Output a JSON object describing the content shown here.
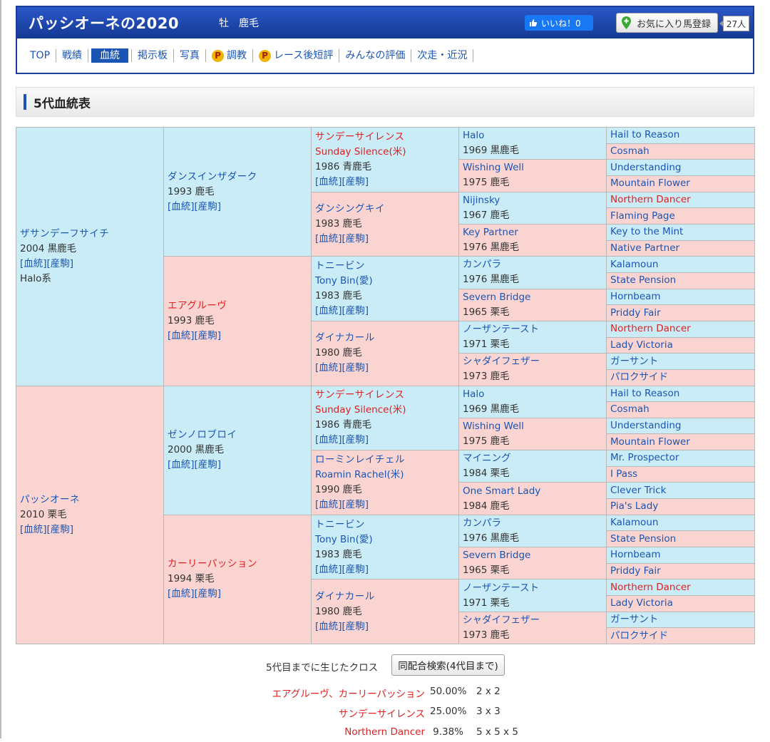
{
  "horse": {
    "name": "パッシオーネの2020",
    "sex_color": "牡　鹿毛",
    "like_label": "いいね！0",
    "fav_label": "お気に入り馬登録",
    "fav_count": "27人"
  },
  "nav": [
    {
      "label": "TOP"
    },
    {
      "label": "戦績"
    },
    {
      "label": "血統",
      "active": true
    },
    {
      "label": "掲示板"
    },
    {
      "label": "写真"
    },
    {
      "label": "調教",
      "premium": true
    },
    {
      "label": "レース後短評",
      "premium": true
    },
    {
      "label": "みんなの評価"
    },
    {
      "label": "次走・近況"
    }
  ],
  "section_title": "5代血統表",
  "pedigree": {
    "sire": {
      "jp": "ザサンデーフサイチ",
      "info": "2004 黒鹿毛",
      "links": "[血統][産駒]",
      "line": "Halo系"
    },
    "dam": {
      "jp": "パッシオーネ",
      "info": "2010 栗毛",
      "links": "[血統][産駒]"
    },
    "g2": [
      {
        "jp": "ダンスインザダーク",
        "info": "1993 鹿毛",
        "links": "[血統][産駒]"
      },
      {
        "jp": "エアグルーヴ",
        "info": "1993 鹿毛",
        "links": "[血統][産駒]",
        "red": true
      },
      {
        "jp": "ゼンノロブロイ",
        "info": "2000 黒鹿毛",
        "links": "[血統][産駒]"
      },
      {
        "jp": "カーリーパッション",
        "info": "1994 栗毛",
        "links": "[血統][産駒]",
        "red": true
      }
    ],
    "g3": [
      {
        "jp": "サンデーサイレンス",
        "en": "Sunday Silence(米)",
        "info": "1986 青鹿毛",
        "links": "[血統][産駒]",
        "red": true
      },
      {
        "jp": "ダンシングキイ",
        "info": "1983 鹿毛",
        "links": "[血統][産駒]"
      },
      {
        "jp": "トニービン",
        "en": "Tony Bin(愛)",
        "info": "1983 鹿毛",
        "links": "[血統][産駒]"
      },
      {
        "jp": "ダイナカール",
        "info": "1980 鹿毛",
        "links": "[血統][産駒]"
      },
      {
        "jp": "サンデーサイレンス",
        "en": "Sunday Silence(米)",
        "info": "1986 青鹿毛",
        "links": "[血統][産駒]",
        "red": true
      },
      {
        "jp": "ローミンレイチェル",
        "en": "Roamin Rachel(米)",
        "info": "1990 鹿毛",
        "links": "[血統][産駒]"
      },
      {
        "jp": "トニービン",
        "en": "Tony Bin(愛)",
        "info": "1983 鹿毛",
        "links": "[血統][産駒]"
      },
      {
        "jp": "ダイナカール",
        "info": "1980 鹿毛",
        "links": "[血統][産駒]"
      }
    ],
    "g4": [
      {
        "name": "Halo",
        "info": "1969 黒鹿毛"
      },
      {
        "name": "Wishing Well",
        "info": "1975 鹿毛"
      },
      {
        "name": "Nijinsky",
        "info": "1967 鹿毛"
      },
      {
        "name": "Key Partner",
        "info": "1976 黒鹿毛"
      },
      {
        "name": "カンパラ",
        "info": "1976 黒鹿毛"
      },
      {
        "name": "Severn Bridge",
        "info": "1965 栗毛"
      },
      {
        "name": "ノーザンテースト",
        "info": "1971 栗毛"
      },
      {
        "name": "シャダイフェザー",
        "info": "1973 鹿毛"
      },
      {
        "name": "Halo",
        "info": "1969 黒鹿毛"
      },
      {
        "name": "Wishing Well",
        "info": "1975 鹿毛"
      },
      {
        "name": "マイニング",
        "info": "1984 栗毛"
      },
      {
        "name": "One Smart Lady",
        "info": "1984 鹿毛"
      },
      {
        "name": "カンパラ",
        "info": "1976 黒鹿毛"
      },
      {
        "name": "Severn Bridge",
        "info": "1965 栗毛"
      },
      {
        "name": "ノーザンテースト",
        "info": "1971 栗毛"
      },
      {
        "name": "シャダイフェザー",
        "info": "1973 鹿毛"
      }
    ],
    "g5": [
      {
        "name": "Hail to Reason"
      },
      {
        "name": "Cosmah"
      },
      {
        "name": "Understanding"
      },
      {
        "name": "Mountain Flower"
      },
      {
        "name": "Northern Dancer",
        "red": true
      },
      {
        "name": "Flaming Page"
      },
      {
        "name": "Key to the Mint"
      },
      {
        "name": "Native Partner"
      },
      {
        "name": "Kalamoun"
      },
      {
        "name": "State Pension"
      },
      {
        "name": "Hornbeam"
      },
      {
        "name": "Priddy Fair"
      },
      {
        "name": "Northern Dancer",
        "red": true
      },
      {
        "name": "Lady Victoria"
      },
      {
        "name": "ガーサント"
      },
      {
        "name": "パロクサイド"
      },
      {
        "name": "Hail to Reason"
      },
      {
        "name": "Cosmah"
      },
      {
        "name": "Understanding"
      },
      {
        "name": "Mountain Flower"
      },
      {
        "name": "Mr. Prospector"
      },
      {
        "name": "I Pass"
      },
      {
        "name": "Clever Trick"
      },
      {
        "name": "Pia's Lady"
      },
      {
        "name": "Kalamoun"
      },
      {
        "name": "State Pension"
      },
      {
        "name": "Hornbeam"
      },
      {
        "name": "Priddy Fair"
      },
      {
        "name": "Northern Dancer",
        "red": true
      },
      {
        "name": "Lady Victoria"
      },
      {
        "name": "ガーサント"
      },
      {
        "name": "パロクサイド"
      }
    ]
  },
  "cross": {
    "label": "5代目までに生じたクロス",
    "button": "同配合検索(4代目まで)",
    "rows": [
      {
        "name": "エアグルーヴ、カーリーパッション",
        "pct": "50.00%",
        "gen": "2 x 2"
      },
      {
        "name": "サンデーサイレンス",
        "pct": "25.00%",
        "gen": "3 x 3"
      },
      {
        "name": "Northern Dancer",
        "pct": "9.38%",
        "gen": "5 x 5 x 5"
      }
    ]
  },
  "colors": {
    "male_bg": "#c9ecf7",
    "female_bg": "#fad4d1",
    "link": "#1a55b4",
    "highlight": "#e02020",
    "header": "#1a3e99"
  }
}
